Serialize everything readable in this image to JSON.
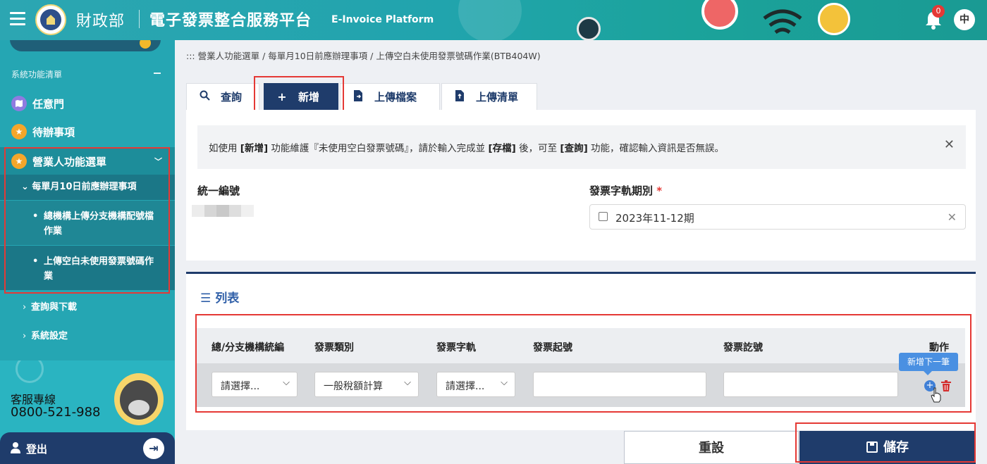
{
  "header": {
    "ministry": "財政部",
    "platform": "電子發票整合服務平台",
    "platform_en": "E-Invoice Platform",
    "notification_count": "0",
    "avatar_initial": "中"
  },
  "sidebar": {
    "section_label": "系統功能清單",
    "items": [
      {
        "label": "任意門",
        "icon": "map-icon"
      },
      {
        "label": "待辦事項",
        "icon": "star-icon"
      },
      {
        "label": "營業人功能選單",
        "icon": "star-icon"
      }
    ],
    "sub_group": "每單月10日前應辦理事項",
    "sub_items": [
      {
        "line1": "總機構上傳分支機構配號檔",
        "line2": "作業"
      },
      {
        "line1": "上傳空白未使用發票號碼作",
        "line2": "業"
      }
    ],
    "children": [
      {
        "label": "查詢與下載"
      },
      {
        "label": "系統設定"
      }
    ],
    "customer_service_label": "客服專線",
    "customer_service_phone": "0800-521-988",
    "logout_label": "登出"
  },
  "breadcrumb": "::: 營業人功能選單  /  每單月10日前應辦理事項  /  上傳空白未使用發票號碼作業(BTB404W)",
  "tabs": [
    {
      "label": "查詢",
      "icon": "search-icon"
    },
    {
      "label": "新增",
      "icon": "plus-icon"
    },
    {
      "label": "上傳檔案",
      "icon": "file-upload-icon"
    },
    {
      "label": "上傳清單",
      "icon": "file-list-icon"
    }
  ],
  "notice": {
    "part1": "如使用 ",
    "bold1": "[新增]",
    "part2": " 功能維護『未使用空白發票號碼』，請於輸入完成並 ",
    "bold2": "[存檔]",
    "part3": " 後，可至 ",
    "bold3": "[查詢]",
    "part4": " 功能，確認輸入資訊是否無誤。"
  },
  "form": {
    "tax_id_label": "統一編號",
    "period_label": "發票字軌期別",
    "period_required_mark": "*",
    "period_value": "2023年11-12期"
  },
  "list": {
    "title": "列表",
    "columns": [
      "總/分支機構統編",
      "發票類別",
      "發票字軌",
      "發票起號",
      "發票訖號",
      "動作"
    ],
    "row": {
      "branch_select": "請選擇...",
      "category_select": "一般稅額計算",
      "track_select": "請選擇...",
      "start_no": "",
      "end_no": ""
    },
    "tooltip": "新增下一筆"
  },
  "buttons": {
    "reset": "重設",
    "save": "儲存"
  },
  "colors": {
    "header_teal": "#21a4ad",
    "sidebar_teal": "#25a6b3",
    "navy": "#1f3c6b",
    "highlight_red": "#e53935",
    "link_blue": "#2f5fa8"
  }
}
